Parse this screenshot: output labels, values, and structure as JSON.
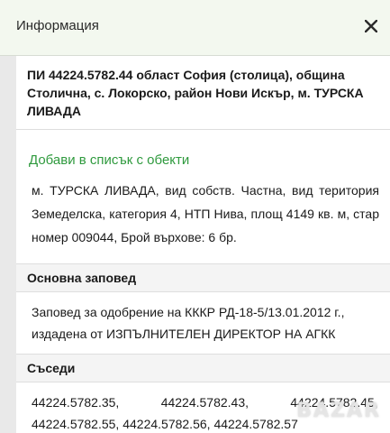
{
  "header": {
    "title": "Информация"
  },
  "property": {
    "title": "ПИ 44224.5782.44 област София (столица), община Столична, с. Локорско, район Нови Искър, м. ТУРСКА ЛИВАДА",
    "add_link": "Добави в списък с обекти",
    "details": "м. ТУРСКА ЛИВАДА, вид собств. Частна, вид територия Земеделска, категория 4, НТП Нива, площ 4149 кв. м, стар номер 009044, Брой върхове: 6 бр."
  },
  "order": {
    "heading": "Основна заповед",
    "text": "Заповед за одобрение на КККР РД-18-5/13.01.2012 г., издадена от ИЗПЪЛНИТЕЛЕН ДИРЕКТОР НА АГКК"
  },
  "neighbors": {
    "heading": "Съседи",
    "items": [
      "44224.5782.35,",
      "44224.5782.43,",
      "44224.5782.45,",
      "44224.5782.55,",
      "44224.5782.56,",
      "44224.5782.57"
    ]
  },
  "watermark": {
    "text": "BAZAR"
  }
}
